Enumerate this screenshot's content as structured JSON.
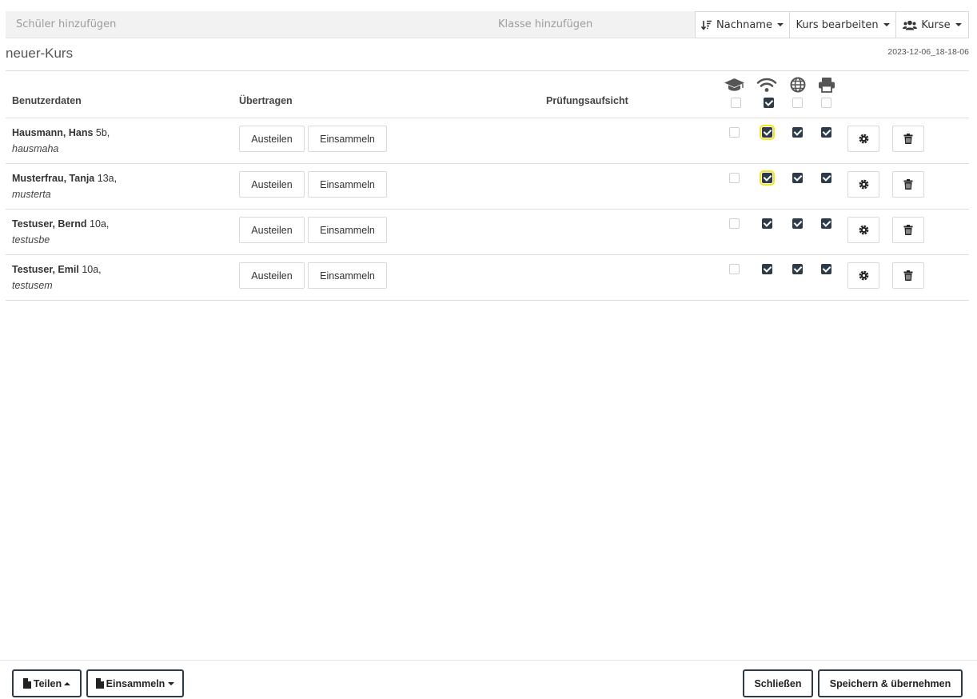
{
  "toolbar": {
    "student_placeholder": "Schüler hinzufügen",
    "class_placeholder": "Klasse hinzufügen",
    "sort_label": "Nachname",
    "sort_icon": "sort-alpha-icon",
    "edit_label": "Kurs bearbeiten",
    "courses_label": "Kurse",
    "courses_icon": "users-icon"
  },
  "course": {
    "title": "neuer-Kurs",
    "timestamp": "2023-12-06_18-18-06"
  },
  "table": {
    "headers": {
      "user": "Benutzerdaten",
      "transfer": "Übertragen",
      "exam": "Prüfungsaufsicht"
    },
    "toggle_columns": [
      {
        "icon": "graduation-cap-icon",
        "all_checked": false
      },
      {
        "icon": "wifi-icon",
        "all_checked": true
      },
      {
        "icon": "globe-icon",
        "all_checked": false
      },
      {
        "icon": "printer-icon",
        "all_checked": false
      }
    ],
    "rows": [
      {
        "name": "Hausmann, Hans",
        "class": "5b,",
        "login": "hausmaha",
        "cap": false,
        "wifi": true,
        "web": true,
        "print": true,
        "wifi_highlight": true
      },
      {
        "name": "Musterfrau, Tanja",
        "class": "13a,",
        "login": "musterta",
        "cap": false,
        "wifi": true,
        "web": true,
        "print": true,
        "wifi_highlight": true
      },
      {
        "name": "Testuser, Bernd",
        "class": "10a,",
        "login": "testusbe",
        "cap": false,
        "wifi": true,
        "web": true,
        "print": true,
        "wifi_highlight": false
      },
      {
        "name": "Testuser, Emil",
        "class": "10a,",
        "login": "testusem",
        "cap": false,
        "wifi": true,
        "web": true,
        "print": true,
        "wifi_highlight": false
      }
    ],
    "row_actions": {
      "distribute": "Austeilen",
      "collect": "Einsammeln",
      "settings_icon": "gear-icon",
      "delete_icon": "trash-icon"
    }
  },
  "footer": {
    "share_label": "Teilen",
    "collect_label": "Einsammeln",
    "close_label": "Schließen",
    "save_label": "Speichern & übernehmen"
  },
  "colors": {
    "checked": "#2d3a48",
    "highlight": "#f4e61a",
    "toolbar_bg": "#f2f2f2"
  }
}
